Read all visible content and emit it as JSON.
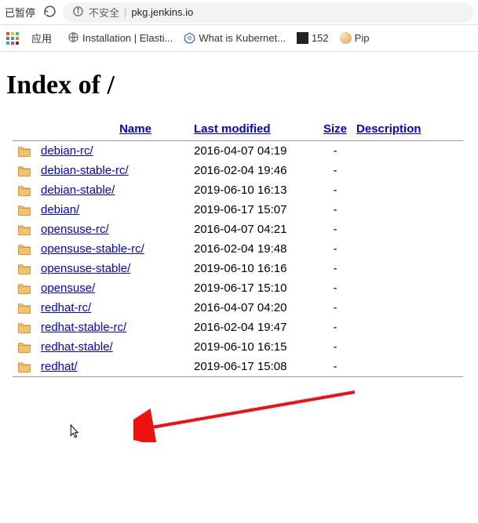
{
  "browser": {
    "tab_status": "已暂停",
    "security_label": "不安全",
    "url": "pkg.jenkins.io"
  },
  "bookmarks": {
    "apps_label": "应用",
    "items": [
      {
        "label": "Installation | Elasti..."
      },
      {
        "label": "What is Kubernet..."
      },
      {
        "label": "152"
      },
      {
        "label": "Pip"
      }
    ]
  },
  "page": {
    "title": "Index of /",
    "headers": {
      "name": "Name",
      "last_modified": "Last modified",
      "size": "Size",
      "description": "Description"
    },
    "rows": [
      {
        "name": "debian-rc/",
        "date": "2016-04-07 04:19",
        "size": "-"
      },
      {
        "name": "debian-stable-rc/",
        "date": "2016-02-04 19:46",
        "size": "-"
      },
      {
        "name": "debian-stable/",
        "date": "2019-06-10 16:13",
        "size": "-"
      },
      {
        "name": "debian/",
        "date": "2019-06-17 15:07",
        "size": "-"
      },
      {
        "name": "opensuse-rc/",
        "date": "2016-04-07 04:21",
        "size": "-"
      },
      {
        "name": "opensuse-stable-rc/",
        "date": "2016-02-04 19:48",
        "size": "-"
      },
      {
        "name": "opensuse-stable/",
        "date": "2019-06-10 16:16",
        "size": "-"
      },
      {
        "name": "opensuse/",
        "date": "2019-06-17 15:10",
        "size": "-"
      },
      {
        "name": "redhat-rc/",
        "date": "2016-04-07 04:20",
        "size": "-"
      },
      {
        "name": "redhat-stable-rc/",
        "date": "2016-02-04 19:47",
        "size": "-"
      },
      {
        "name": "redhat-stable/",
        "date": "2019-06-10 16:15",
        "size": "-"
      },
      {
        "name": "redhat/",
        "date": "2019-06-17 15:08",
        "size": "-"
      }
    ]
  }
}
